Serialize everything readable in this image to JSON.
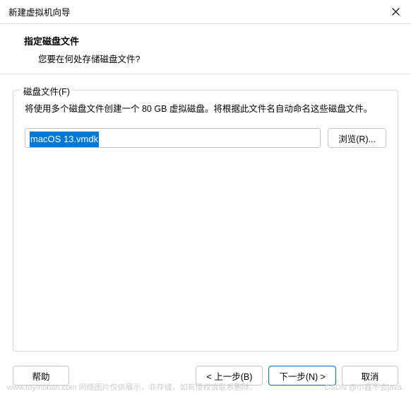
{
  "titlebar": {
    "title": "新建虚拟机向导"
  },
  "header": {
    "title": "指定磁盘文件",
    "subtitle": "您要在何处存储磁盘文件?"
  },
  "fieldset": {
    "legend": "磁盘文件(F)",
    "description": "将使用多个磁盘文件创建一个 80 GB 虚拟磁盘。将根据此文件名自动命名这些磁盘文件。",
    "file_value": "macOS 13.vmdk",
    "browse_label": "浏览(R)..."
  },
  "footer": {
    "help_label": "帮助",
    "back_label": "< 上一步(B)",
    "next_label": "下一步(N) >",
    "cancel_label": "取消"
  },
  "watermark": {
    "left": "www.toymoban.com 网络图片仅供展示，非存储，如有侵权请联系删除。",
    "right": "CSDN @小鑫不会java."
  }
}
